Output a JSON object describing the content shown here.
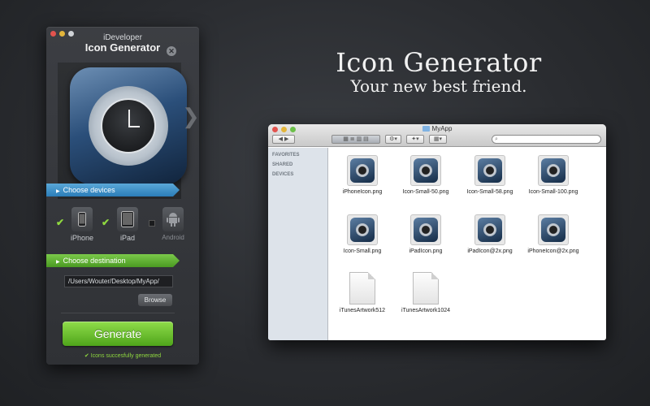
{
  "app": {
    "subtitle": "iDeveloper",
    "title": "Icon Generator",
    "close_glyph": "✕",
    "side_arrow": "❯",
    "section_devices": "Choose devices",
    "section_destination": "Choose destination",
    "devices": [
      {
        "label": "iPhone",
        "checked": true
      },
      {
        "label": "iPad",
        "checked": true
      },
      {
        "label": "Android",
        "checked": false
      }
    ],
    "check_glyph": "✔",
    "destination_path": "/Users/Wouter/Desktop/MyApp/",
    "browse_label": "Browse",
    "generate_label": "Generate",
    "status_text": "Icons succesfully generated",
    "accent_blue": "#2b7db8",
    "accent_green": "#4fa51b"
  },
  "headline": {
    "title": "Icon Generator",
    "tagline": "Your new best friend."
  },
  "finder": {
    "window_title": "MyApp",
    "back_glyph": "◀",
    "forward_glyph": "▶",
    "search_glyph": "⌕",
    "sidebar": [
      "FAVORITES",
      "SHARED",
      "DEVICES"
    ],
    "files": [
      {
        "name": "iPhoneIcon.png",
        "kind": "image"
      },
      {
        "name": "Icon-Small-50.png",
        "kind": "image"
      },
      {
        "name": "Icon-Small-58.png",
        "kind": "image"
      },
      {
        "name": "Icon-Small-100.png",
        "kind": "image"
      },
      {
        "name": "Icon-Small.png",
        "kind": "image"
      },
      {
        "name": "iPadIcon.png",
        "kind": "image"
      },
      {
        "name": "iPadIcon@2x.png",
        "kind": "image"
      },
      {
        "name": "iPhoneIcon@2x.png",
        "kind": "image"
      },
      {
        "name": "iTunesArtwork512",
        "kind": "document"
      },
      {
        "name": "iTunesArtwork1024",
        "kind": "document"
      }
    ]
  }
}
